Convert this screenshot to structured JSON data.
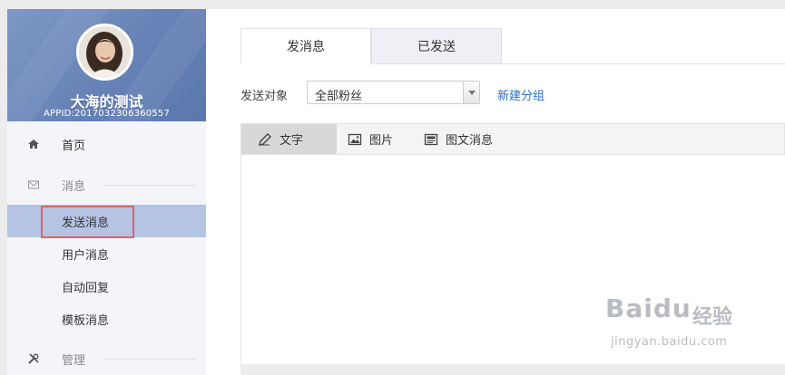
{
  "profile": {
    "name": "大海的测试",
    "appid": "APPID:2017032306360557"
  },
  "sidebar": {
    "home": "首页",
    "message_section": "消息",
    "items": [
      {
        "label": "发送消息"
      },
      {
        "label": "用户消息"
      },
      {
        "label": "自动回复"
      },
      {
        "label": "模板消息"
      }
    ],
    "manage_section": "管理"
  },
  "tabs": [
    {
      "label": "发消息",
      "active": true
    },
    {
      "label": "已发送",
      "active": false
    }
  ],
  "send_target": {
    "label": "发送对象",
    "selected": "全部粉丝",
    "new_group_link": "新建分组"
  },
  "editor": {
    "tabs": [
      {
        "label": "文字",
        "icon": "pencil-icon",
        "active": true
      },
      {
        "label": "图片",
        "icon": "image-icon",
        "active": false
      },
      {
        "label": "图文消息",
        "icon": "article-icon",
        "active": false
      }
    ]
  },
  "watermark": {
    "logo": "Baidu",
    "cn": "经验",
    "url": "jingyan.baidu.com"
  },
  "colors": {
    "sidebar_header": "#6682b6",
    "active_item": "#b5c4e2",
    "link": "#2b6fc4",
    "highlight": "#e06166"
  }
}
